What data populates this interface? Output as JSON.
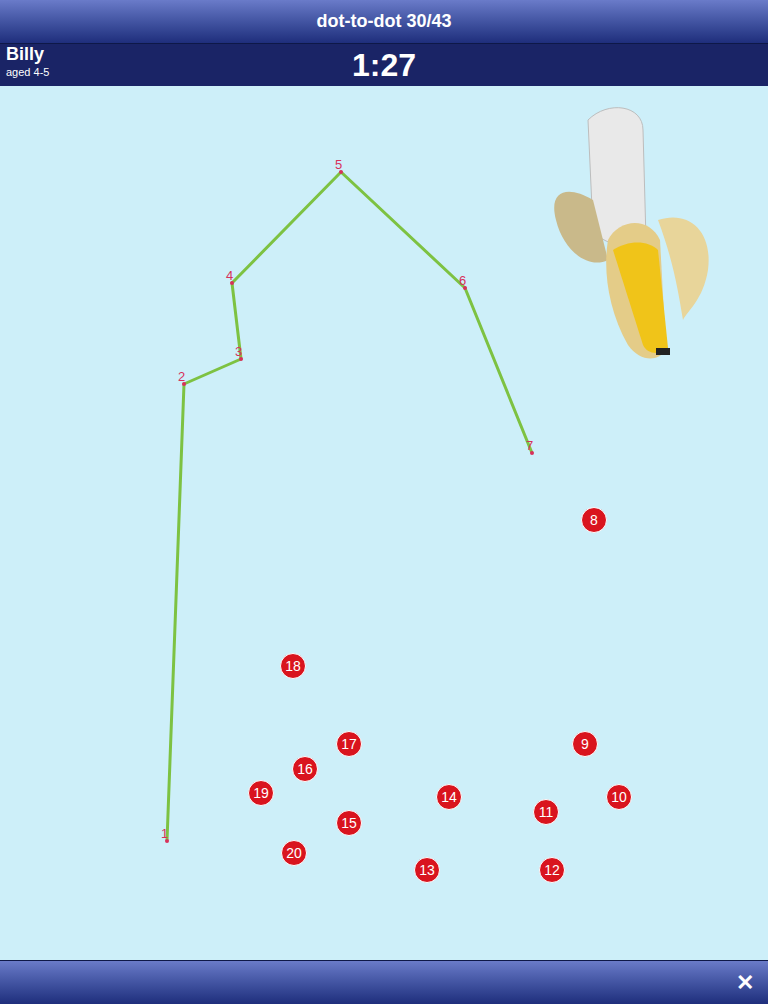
{
  "header": {
    "title": "dot-to-dot 30/43"
  },
  "player": {
    "name": "Billy",
    "age": "aged 4-5"
  },
  "timer": "1:27",
  "dots": [
    {
      "label": "1",
      "connected": true
    },
    {
      "label": "2",
      "connected": true
    },
    {
      "label": "3",
      "connected": true
    },
    {
      "label": "4",
      "connected": true
    },
    {
      "label": "5",
      "connected": true
    },
    {
      "label": "6",
      "connected": true
    },
    {
      "label": "7",
      "connected": true
    },
    {
      "label": "8",
      "connected": false
    },
    {
      "label": "9",
      "connected": false
    },
    {
      "label": "10",
      "connected": false
    },
    {
      "label": "11",
      "connected": false
    },
    {
      "label": "12",
      "connected": false
    },
    {
      "label": "13",
      "connected": false
    },
    {
      "label": "14",
      "connected": false
    },
    {
      "label": "15",
      "connected": false
    },
    {
      "label": "16",
      "connected": false
    },
    {
      "label": "17",
      "connected": false
    },
    {
      "label": "18",
      "connected": false
    },
    {
      "label": "19",
      "connected": false
    },
    {
      "label": "20",
      "connected": false
    }
  ],
  "footer": {
    "close": "✕"
  }
}
